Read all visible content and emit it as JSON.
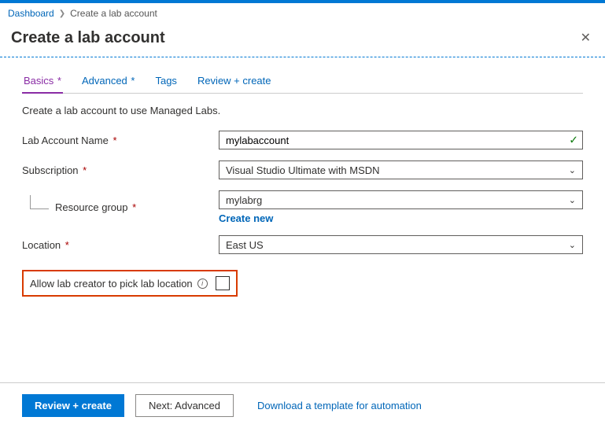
{
  "breadcrumb": {
    "root": "Dashboard",
    "current": "Create a lab account"
  },
  "header": {
    "title": "Create a lab account"
  },
  "tabs": [
    {
      "label": "Basics",
      "required": true,
      "active": true
    },
    {
      "label": "Advanced",
      "required": true,
      "active": false
    },
    {
      "label": "Tags",
      "required": false,
      "active": false
    },
    {
      "label": "Review + create",
      "required": false,
      "active": false
    }
  ],
  "description": "Create a lab account to use Managed Labs.",
  "fields": {
    "labAccountName": {
      "label": "Lab Account Name",
      "value": "mylabaccount"
    },
    "subscription": {
      "label": "Subscription",
      "value": "Visual Studio Ultimate with MSDN"
    },
    "resourceGroup": {
      "label": "Resource group",
      "value": "mylabrg",
      "createNew": "Create new"
    },
    "location": {
      "label": "Location",
      "value": "East US"
    },
    "allowPick": {
      "label": "Allow lab creator to pick lab location"
    }
  },
  "footer": {
    "primary": "Review + create",
    "secondary": "Next: Advanced",
    "link": "Download a template for automation"
  }
}
